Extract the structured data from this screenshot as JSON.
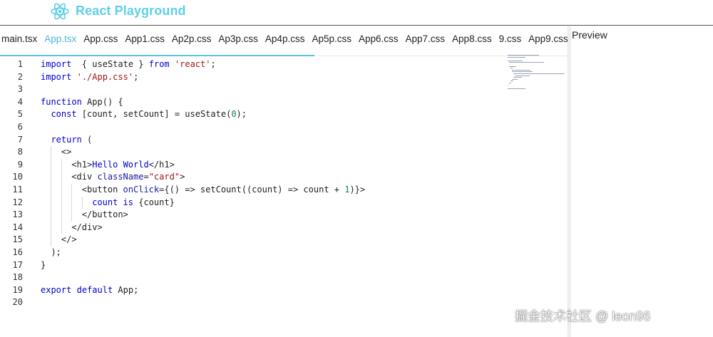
{
  "header": {
    "title": "React Playground"
  },
  "tabs": [
    {
      "label": "main.tsx",
      "active": false
    },
    {
      "label": "App.tsx",
      "active": true
    },
    {
      "label": "App.css",
      "active": false
    },
    {
      "label": "App1.css",
      "active": false
    },
    {
      "label": "Ap2p.css",
      "active": false
    },
    {
      "label": "Ap3p.css",
      "active": false
    },
    {
      "label": "Ap4p.css",
      "active": false
    },
    {
      "label": "Ap5p.css",
      "active": false
    },
    {
      "label": "App6.css",
      "active": false
    },
    {
      "label": "App7.css",
      "active": false
    },
    {
      "label": "App8.css",
      "active": false
    },
    {
      "label": "9.css",
      "active": false
    },
    {
      "label": "App9.css",
      "active": false
    }
  ],
  "editor": {
    "lines": [
      {
        "n": "1",
        "indent": 0,
        "tokens": [
          [
            "kw",
            "import"
          ],
          [
            "",
            "  { "
          ],
          [
            "",
            "useState"
          ],
          [
            "",
            " } "
          ],
          [
            "kw",
            "from"
          ],
          [
            "",
            " "
          ],
          [
            "str",
            "'react'"
          ],
          [
            "",
            ";"
          ]
        ]
      },
      {
        "n": "2",
        "indent": 0,
        "tokens": [
          [
            "kw",
            "import"
          ],
          [
            "",
            " "
          ],
          [
            "str",
            "'./App.css'"
          ],
          [
            "",
            ";"
          ]
        ]
      },
      {
        "n": "3",
        "indent": 0,
        "tokens": []
      },
      {
        "n": "4",
        "indent": 0,
        "tokens": [
          [
            "kw",
            "function"
          ],
          [
            "",
            " "
          ],
          [
            "",
            "App"
          ],
          [
            "",
            "() {"
          ]
        ]
      },
      {
        "n": "5",
        "indent": 1,
        "tokens": [
          [
            "kw",
            "const"
          ],
          [
            "",
            " [count, setCount] = "
          ],
          [
            "",
            "useState"
          ],
          [
            "",
            "("
          ],
          [
            "num",
            "0"
          ],
          [
            "",
            ");"
          ]
        ]
      },
      {
        "n": "6",
        "indent": 0,
        "tokens": []
      },
      {
        "n": "7",
        "indent": 1,
        "tokens": [
          [
            "kw",
            "return"
          ],
          [
            "",
            " ("
          ]
        ]
      },
      {
        "n": "8",
        "indent": 2,
        "tokens": [
          [
            "tag",
            "<>"
          ]
        ]
      },
      {
        "n": "9",
        "indent": 3,
        "tokens": [
          [
            "tag",
            "<h1>"
          ],
          [
            "txt",
            "Hello World"
          ],
          [
            "tag",
            "</h1>"
          ]
        ]
      },
      {
        "n": "10",
        "indent": 3,
        "tokens": [
          [
            "tag",
            "<div "
          ],
          [
            "attr",
            "className"
          ],
          [
            "",
            "="
          ],
          [
            "str",
            "\"card\""
          ],
          [
            "tag",
            ">"
          ]
        ]
      },
      {
        "n": "11",
        "indent": 4,
        "tokens": [
          [
            "tag",
            "<button "
          ],
          [
            "attr",
            "onClick"
          ],
          [
            "",
            "={() => "
          ],
          [
            "",
            "setCount"
          ],
          [
            "",
            "((count) => count + "
          ],
          [
            "num",
            "1"
          ],
          [
            "",
            ")}"
          ],
          [
            "tag",
            ">"
          ]
        ]
      },
      {
        "n": "12",
        "indent": 5,
        "tokens": [
          [
            "txt",
            "count is "
          ],
          [
            "",
            "{count}"
          ]
        ]
      },
      {
        "n": "13",
        "indent": 4,
        "tokens": [
          [
            "tag",
            "</button>"
          ]
        ]
      },
      {
        "n": "14",
        "indent": 3,
        "tokens": [
          [
            "tag",
            "</div>"
          ]
        ]
      },
      {
        "n": "15",
        "indent": 2,
        "tokens": [
          [
            "tag",
            "</>"
          ]
        ]
      },
      {
        "n": "16",
        "indent": 1,
        "tokens": [
          [
            "",
            ");"
          ]
        ]
      },
      {
        "n": "17",
        "indent": 0,
        "tokens": [
          [
            "",
            "}"
          ]
        ]
      },
      {
        "n": "18",
        "indent": 0,
        "tokens": []
      },
      {
        "n": "19",
        "indent": 0,
        "tokens": [
          [
            "kw",
            "export"
          ],
          [
            "",
            " "
          ],
          [
            "kw",
            "default"
          ],
          [
            "",
            " App;"
          ]
        ]
      },
      {
        "n": "20",
        "indent": 0,
        "tokens": []
      }
    ]
  },
  "preview": {
    "title": "Preview"
  },
  "watermark": {
    "text": "掘金技术社区 @ leon96"
  },
  "colors": {
    "brand": "#5fcfe6",
    "active_tab": "#4ab7d8",
    "keyword": "#0000cc",
    "string": "#a31515",
    "number": "#098658"
  },
  "icons": {
    "logo": "react-atom-icon"
  }
}
